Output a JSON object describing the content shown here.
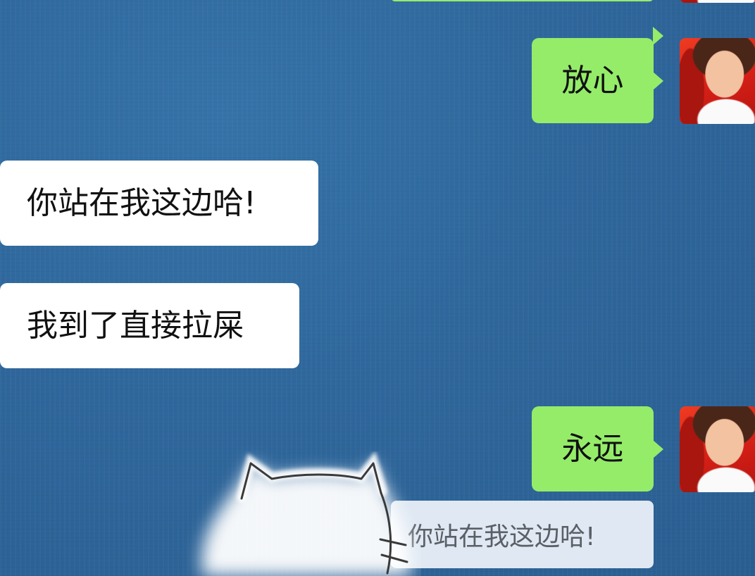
{
  "messages": [
    {
      "side": "right",
      "text": "放心"
    },
    {
      "side": "left",
      "text": "你站在我这边哈!"
    },
    {
      "side": "left",
      "text": "我到了直接拉屎"
    },
    {
      "side": "right",
      "text": "永远"
    }
  ],
  "reply_quote": {
    "text": "你站在我这边哈!"
  },
  "colors": {
    "outgoing_bubble": "#95ec69",
    "incoming_bubble": "#ffffff",
    "background": "#2f679c",
    "quote_bubble": "#dfe8f3"
  },
  "icons": {
    "sticker_overlay": "cat-sticker-icon"
  }
}
